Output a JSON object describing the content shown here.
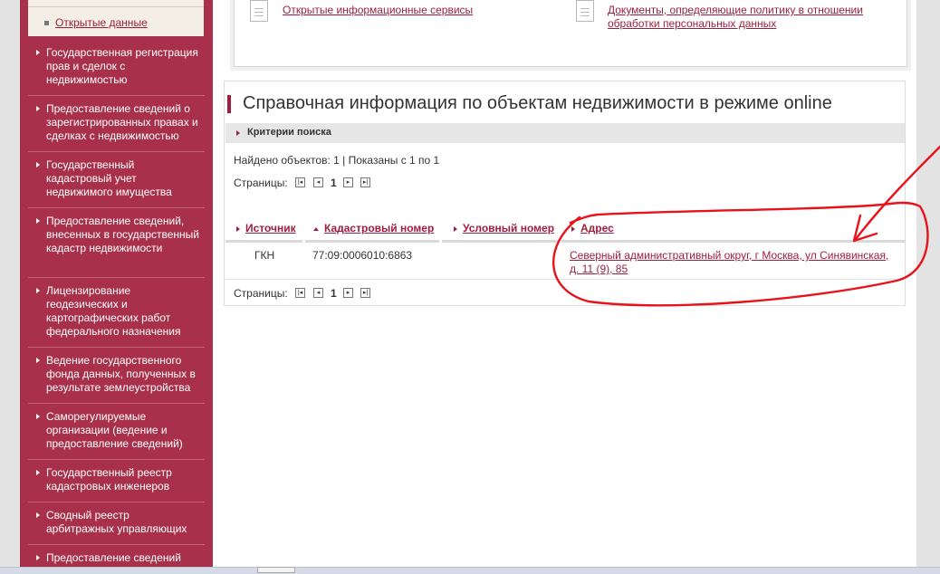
{
  "sidebar": {
    "subitem": "Открытые данные",
    "items": [
      {
        "label": "Государственная регистрация прав и сделок с недвижимостью"
      },
      {
        "label": "Предоставление сведений о зарегистрированных правах и сделках с недвижимостью"
      },
      {
        "label": "Государственный кадастровый учет недвижимого имущества"
      },
      {
        "label": "Предоставление сведений, внесенных в государственный кадастр недвижимости"
      },
      {
        "label": "Лицензирование геодезических и картографических работ федерального назначения"
      },
      {
        "label": "Ведение государственного фонда данных, полученных в результате землеустройства"
      },
      {
        "label": "Саморегулируемые организации (ведение и предоставление сведений)"
      },
      {
        "label": "Государственный реестр кадастровых инженеров"
      },
      {
        "label": "Сводный реестр арбитражных управляющих"
      },
      {
        "label": "Предоставление сведений"
      }
    ]
  },
  "top_links": {
    "left": "Открытые информационные сервисы",
    "right": "Документы, определяющие политику в отношении обработки персональных данных"
  },
  "panel": {
    "title": "Справочная информация по объектам недвижимости в режиме online",
    "criteria_label": "Критерии поиска",
    "found_text": "Найдено объектов: 1 | Показаны с 1 по 1",
    "pages_label": "Страницы:",
    "current_page": "1",
    "pager_icons": [
      "first-page-icon",
      "prev-page-icon",
      "next-page-icon",
      "last-page-icon"
    ],
    "columns": [
      "Источник",
      "Кадастровый номер",
      "Условный номер",
      "Адрес"
    ],
    "rows": [
      {
        "source": "ГКН",
        "cadastral_number": "77:09:0006010:6863",
        "conditional_number": "",
        "address": "Северный административный округ, г Москва, ул Синявинская, д. 11 (9), 85"
      }
    ]
  },
  "colors": {
    "sidebar_bg": "#a8304a",
    "accent": "#9e1e3e",
    "annotation": "#e8121b"
  }
}
